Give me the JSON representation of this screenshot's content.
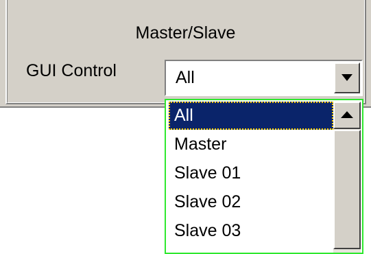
{
  "group": {
    "title": "Master/Slave"
  },
  "gui_control": {
    "label": "GUI Control",
    "selected_value": "All"
  },
  "dropdown": {
    "options": [
      "All",
      "Master",
      "Slave 01",
      "Slave 02",
      "Slave 03"
    ],
    "highlighted_index": 0
  },
  "colors": {
    "panel_bg": "#d4d0c8",
    "selection_bg": "#0a246a",
    "dropdown_border": "#2ee82e"
  },
  "icons": {
    "combo_arrow": "chevron-down-icon",
    "scroll_up": "arrow-up-icon"
  }
}
